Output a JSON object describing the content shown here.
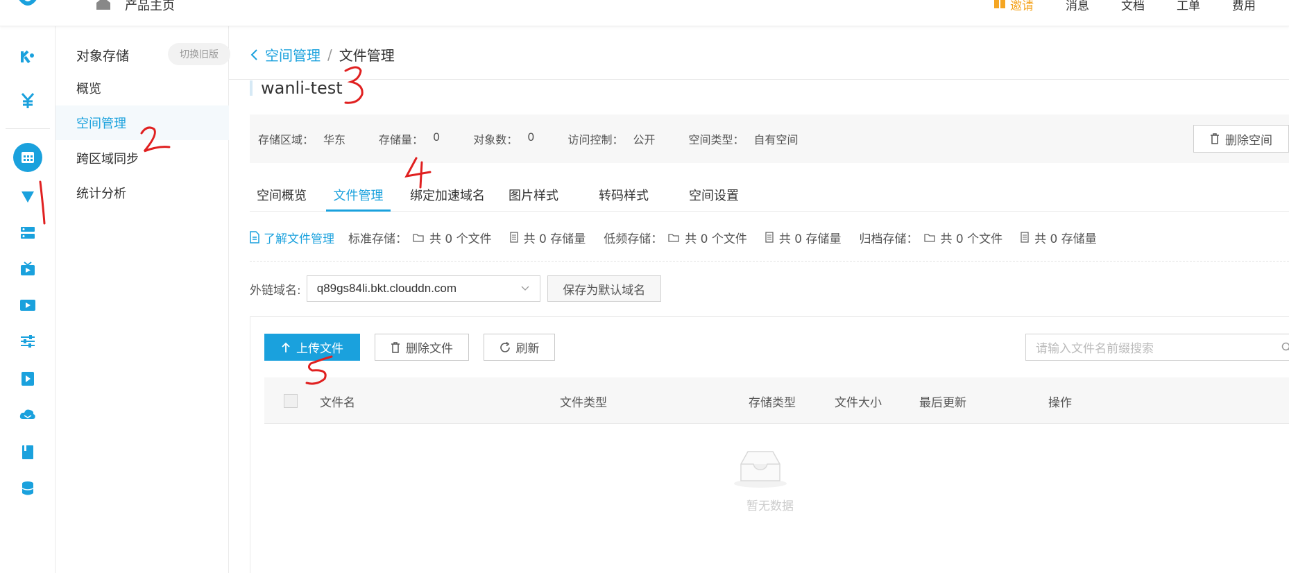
{
  "topbar": {
    "home_label": "产品主页",
    "links": [
      "邀请",
      "消息",
      "文档",
      "工单",
      "费用"
    ]
  },
  "sidebar": {
    "title": "对象存储",
    "switch_label": "切换旧版",
    "items": [
      {
        "label": "概览"
      },
      {
        "label": "空间管理",
        "active": true
      },
      {
        "label": "跨区域同步"
      },
      {
        "label": "统计分析"
      }
    ]
  },
  "rail_icons": [
    "kodo-icon",
    "billing-icon",
    "storage-app-icon",
    "cdn-icon",
    "server-icon",
    "live-icon",
    "media-icon",
    "settings-sliders-icon",
    "player-icon",
    "cloud-mail-icon",
    "book-icon",
    "database-icon"
  ],
  "breadcrumb": {
    "parent": "空间管理",
    "separator": "/",
    "current": "文件管理"
  },
  "bucket": {
    "name": "wanli-test"
  },
  "info": [
    {
      "label": "存储区域：",
      "value": "华东"
    },
    {
      "label": "存储量：",
      "value": "0"
    },
    {
      "label": "对象数：",
      "value": "0"
    },
    {
      "label": "访问控制：",
      "value": "公开"
    },
    {
      "label": "空间类型：",
      "value": "自有空间"
    }
  ],
  "delete_space_label": "删除空间",
  "tabs": [
    {
      "label": "空间概览"
    },
    {
      "label": "文件管理",
      "active": true
    },
    {
      "label": "绑定加速域名"
    },
    {
      "label": "图片样式"
    },
    {
      "label": "转码样式"
    },
    {
      "label": "空间设置"
    }
  ],
  "stats": {
    "learn_label": "了解文件管理",
    "groups": [
      {
        "label": "标准存储：",
        "files": "共 0 个文件",
        "size": "共 0 存储量"
      },
      {
        "label": "低频存储：",
        "files": "共 0 个文件",
        "size": "共 0 存储量"
      },
      {
        "label": "归档存储：",
        "files": "共 0 个文件",
        "size": "共 0 存储量"
      }
    ]
  },
  "domain": {
    "label": "外链域名:",
    "value": "q89gs84li.bkt.clouddn.com",
    "save_default_label": "保存为默认域名"
  },
  "toolbar": {
    "upload_label": "上传文件",
    "delete_label": "删除文件",
    "refresh_label": "刷新",
    "search_placeholder": "请输入文件名前缀搜索"
  },
  "table": {
    "columns": [
      "文件名",
      "文件类型",
      "存储类型",
      "文件大小",
      "最后更新",
      "操作"
    ],
    "rows": [],
    "empty_text": "暂无数据"
  },
  "annotations": [
    "1",
    "2",
    "3",
    "4",
    "5"
  ],
  "colors": {
    "accent": "#1aa1dd",
    "annotation": "#e02020"
  }
}
